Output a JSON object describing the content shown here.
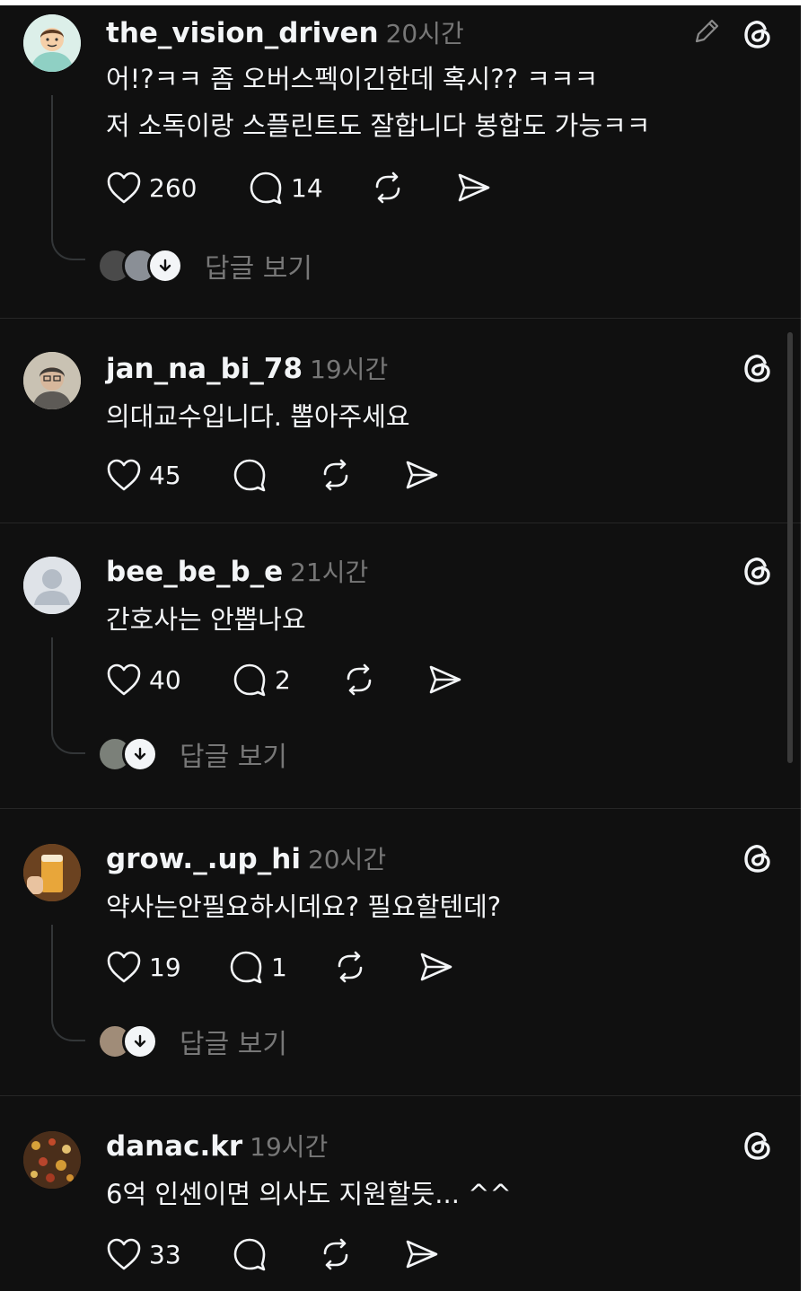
{
  "posts": [
    {
      "username": "the_vision_driven",
      "time": "20시간",
      "lines": [
        "어!?ㅋㅋ 좀 오버스펙이긴한데 혹시?? ㅋㅋㅋ",
        "저 소독이랑 스플린트도 잘합니다 봉합도 가능ㅋㅋ"
      ],
      "likes": "260",
      "comments": "14",
      "view_replies": "답글 보기",
      "avatar_icon": "doctor-avatar"
    },
    {
      "username": "jan_na_bi_78",
      "time": "19시간",
      "lines": [
        "의대교수입니다. 뽑아주세요"
      ],
      "likes": "45",
      "comments": "",
      "avatar_icon": "photo-avatar"
    },
    {
      "username": "bee_be_b_e",
      "time": "21시간",
      "lines": [
        "간호사는 안뽑나요"
      ],
      "likes": "40",
      "comments": "2",
      "view_replies": "답글 보기",
      "avatar_icon": "default-avatar"
    },
    {
      "username": "grow._.up_hi",
      "time": "20시간",
      "lines": [
        "약사는안필요하시데요? 필요할텐데?"
      ],
      "likes": "19",
      "comments": "1",
      "view_replies": "답글 보기",
      "avatar_icon": "beer-photo-avatar"
    },
    {
      "username": "danac.kr",
      "time": "19시간",
      "lines": [
        "6억 인센이면 의사도 지원할듯... ^^"
      ],
      "likes": "33",
      "comments": "",
      "avatar_icon": "pattern-avatar"
    }
  ],
  "colors": {
    "background": "#101010",
    "text": "#f3f5f7",
    "muted": "#777777",
    "divider": "#262626"
  }
}
